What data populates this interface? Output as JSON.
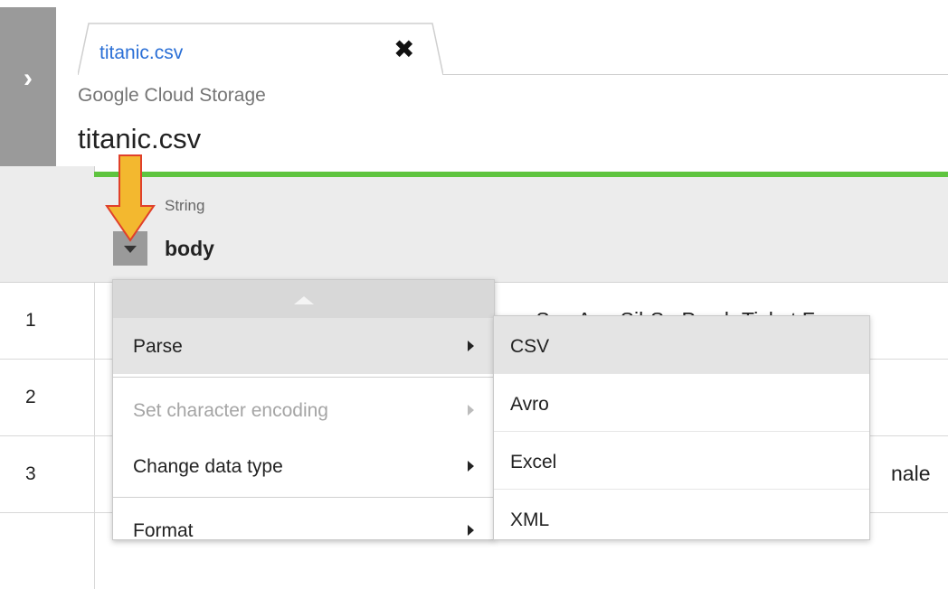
{
  "sidebar": {
    "toggle_icon": "chevron-right-icon"
  },
  "tab": {
    "label": "titanic.csv",
    "close_icon": "close-icon"
  },
  "source_label": "Google Cloud Storage",
  "file_title": "titanic.csv",
  "colors": {
    "accent": "#5fc43f",
    "link": "#2a6fd6",
    "annotation_arrow": "#f3b82f"
  },
  "column": {
    "type": "String",
    "name": "body",
    "menu_icon": "caret-down-icon"
  },
  "rows": [
    {
      "num": "1",
      "text": "me,Sex,Age,SibSp,Parch,Ticket,Far"
    },
    {
      "num": "2",
      "text": ""
    },
    {
      "num": "3",
      "text": "nale"
    }
  ],
  "menu": {
    "items": [
      {
        "label": "Parse",
        "state": "active"
      },
      {
        "label": "Set character encoding",
        "state": "disabled"
      },
      {
        "label": "Change data type",
        "state": "normal"
      },
      {
        "label": "Format",
        "state": "normal"
      }
    ]
  },
  "submenu": {
    "items": [
      "CSV",
      "Avro",
      "Excel",
      "XML"
    ],
    "selected": "CSV"
  }
}
